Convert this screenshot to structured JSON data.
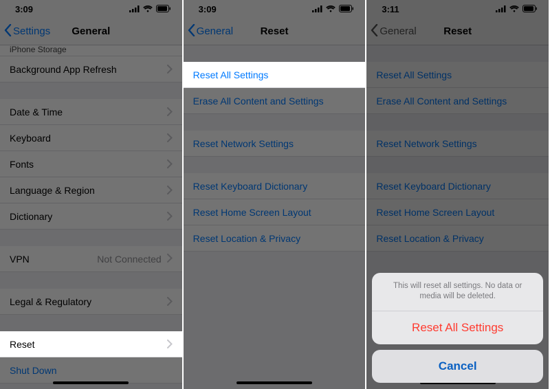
{
  "status": {
    "time_a": "3:09",
    "time_b": "3:09",
    "time_c": "3:11"
  },
  "screen1": {
    "back": "Settings",
    "title": "General",
    "row_partial": "iPhone Storage",
    "row_bg_refresh": "Background App Refresh",
    "row_date": "Date & Time",
    "row_keyboard": "Keyboard",
    "row_fonts": "Fonts",
    "row_lang": "Language & Region",
    "row_dict": "Dictionary",
    "row_vpn": "VPN",
    "row_vpn_val": "Not Connected",
    "row_legal": "Legal & Regulatory",
    "row_reset": "Reset",
    "row_shutdown": "Shut Down"
  },
  "screen2": {
    "back": "General",
    "title": "Reset",
    "items": {
      "reset_all": "Reset All Settings",
      "erase_all": "Erase All Content and Settings",
      "reset_net": "Reset Network Settings",
      "reset_kb": "Reset Keyboard Dictionary",
      "reset_home": "Reset Home Screen Layout",
      "reset_loc": "Reset Location & Privacy"
    }
  },
  "screen3": {
    "back": "General",
    "title": "Reset",
    "sheet_msg": "This will reset all settings. No data or media will be deleted.",
    "sheet_action": "Reset All Settings",
    "sheet_cancel": "Cancel"
  }
}
